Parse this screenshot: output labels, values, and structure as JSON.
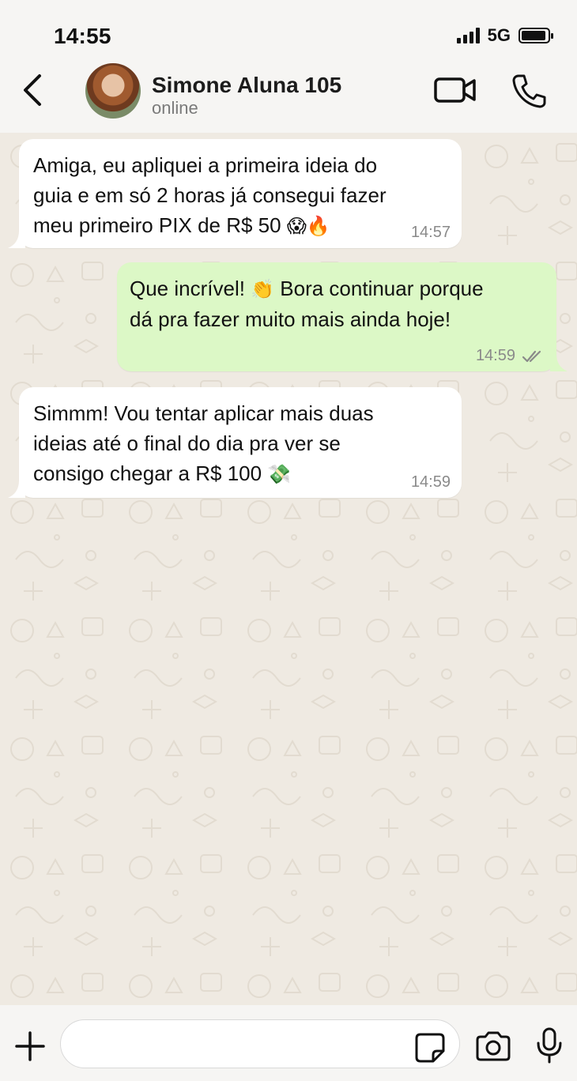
{
  "status_bar": {
    "time": "14:55",
    "network": "5G",
    "battery_level": 0.95
  },
  "header": {
    "contact_name": "Simone Aluna 105",
    "contact_status": "online"
  },
  "messages": [
    {
      "direction": "incoming",
      "lines": [
        "Amiga, eu apliquei a primeira ideia do",
        "guia e em só 2 horas já consegui fazer",
        "meu primeiro PIX de R$ 50 "
      ],
      "emoji": "😱🔥",
      "time": "14:57"
    },
    {
      "direction": "outgoing",
      "lines": [
        "Que incrível! ",
        "dá pra fazer muito mais ainda hoje!"
      ],
      "emoji": "👏",
      "line1_rest": " Bora continuar porque",
      "time": "14:59",
      "read": true
    },
    {
      "direction": "incoming",
      "lines": [
        "Simmm! Vou tentar aplicar mais duas",
        "ideias até o final do dia pra ver se",
        "consigo chegar a R$ 100 "
      ],
      "emoji": "💸",
      "time": "14:59"
    }
  ],
  "icons": {
    "back": "chevron-left-icon",
    "video": "video-camera-icon",
    "call": "phone-icon",
    "attach": "plus-icon",
    "sticker": "sticker-icon",
    "camera": "camera-icon",
    "mic": "microphone-icon",
    "read_receipt": "double-check-icon"
  },
  "colors": {
    "incoming_bubble": "#ffffff",
    "outgoing_bubble": "#dcf8c6",
    "chat_background": "#efeae2",
    "read_check": "#8a8a8a"
  },
  "input": {
    "placeholder": ""
  }
}
